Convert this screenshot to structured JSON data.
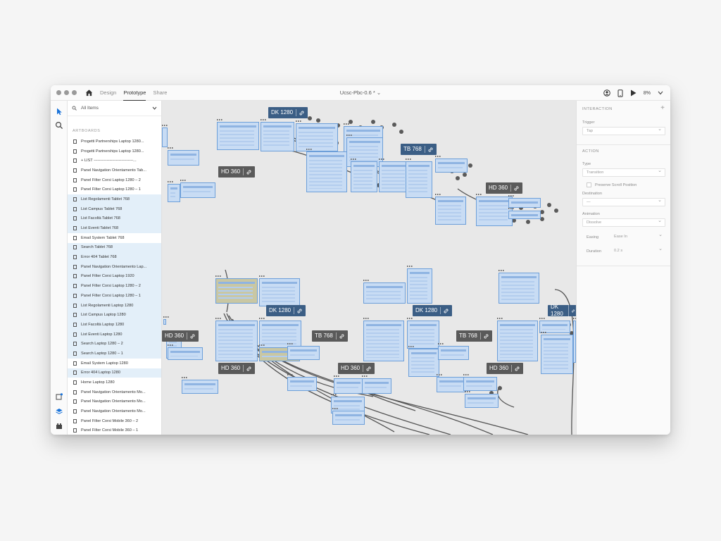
{
  "titlebar": {
    "tabs": [
      "Design",
      "Prototype",
      "Share"
    ],
    "active_tab": "Prototype",
    "document_title": "Ucsc-Pbc-0.6 * ⌄",
    "zoom": "8%"
  },
  "layers": {
    "search_label": "All Items",
    "section_title": "ARTBOARDS",
    "items": [
      {
        "label": "Progetti Partnerships Laptop 1280...",
        "selected": false
      },
      {
        "label": "Progetti Partnerships Laptop 1280...",
        "selected": false
      },
      {
        "label": "+ LIST ------------------------------...",
        "selected": false
      },
      {
        "label": "Panel Navigation Orientamento Tab...",
        "selected": false
      },
      {
        "label": "Panel Filter Corsi Laptop 1280 – 2",
        "selected": false
      },
      {
        "label": "Panel Filter Corsi Laptop 1280 – 1",
        "selected": false
      },
      {
        "label": "List Regolamenti Tablet 768",
        "selected": true
      },
      {
        "label": "List Campus Tablet 768",
        "selected": true
      },
      {
        "label": "List Facoltà Tablet 768",
        "selected": true
      },
      {
        "label": "List Eventi Tablet 768",
        "selected": true
      },
      {
        "label": "Email System Tablet 768",
        "selected": false
      },
      {
        "label": "Search Tablet 768",
        "selected": true
      },
      {
        "label": "Error 404 Tablet 768",
        "selected": true
      },
      {
        "label": "Panel Navigation Orientamento Lap...",
        "selected": true
      },
      {
        "label": "Panel Filter Corsi Laptop 1920",
        "selected": true
      },
      {
        "label": "Panel Filter Corsi Laptop 1280 – 2",
        "selected": true
      },
      {
        "label": "Panel Filter Corsi Laptop 1280 – 1",
        "selected": true
      },
      {
        "label": "List Regolamenti Laptop 1280",
        "selected": true
      },
      {
        "label": "List Campus Laptop 1280",
        "selected": true
      },
      {
        "label": "List Facoltà Laptop 1280",
        "selected": true
      },
      {
        "label": "List Eventi Laptop 1280",
        "selected": true
      },
      {
        "label": "Search Laptop 1280 – 2",
        "selected": true
      },
      {
        "label": "Search Laptop 1280 – 1",
        "selected": true
      },
      {
        "label": "Email System Laptop 1280",
        "selected": false
      },
      {
        "label": "Error 404 Laptop 1280",
        "selected": true
      },
      {
        "label": "Home Laptop 1280",
        "selected": false
      },
      {
        "label": "Panel Navigation Orientamento Mo...",
        "selected": false
      },
      {
        "label": "Panel Navigation Orientamento Mo...",
        "selected": false
      },
      {
        "label": "Panel Navigation Orientamento Mo...",
        "selected": false
      },
      {
        "label": "Panel Filter Corsi Mobile 360 – 2",
        "selected": false
      },
      {
        "label": "Panel Filter Corsi Mobile 360 – 1",
        "selected": false
      }
    ]
  },
  "canvas": {
    "tags": [
      {
        "label": "DK 1280",
        "style": "blue"
      },
      {
        "label": "TB 768",
        "style": "blue"
      },
      {
        "label": "HD 360",
        "style": "gray"
      },
      {
        "label": "HD 360",
        "style": "gray"
      },
      {
        "label": "DK 1280",
        "style": "blue"
      },
      {
        "label": "DK 1280",
        "style": "blue"
      },
      {
        "label": "DK 1280",
        "style": "blue"
      },
      {
        "label": "TB 768",
        "style": "gray"
      },
      {
        "label": "TB 768",
        "style": "gray"
      },
      {
        "label": "TB 768",
        "style": "gray"
      },
      {
        "label": "HD 360",
        "style": "gray"
      },
      {
        "label": "HD 360",
        "style": "gray"
      },
      {
        "label": "HD 360",
        "style": "gray"
      },
      {
        "label": "HD 360",
        "style": "gray"
      }
    ]
  },
  "inspector": {
    "interaction_title": "INTERACTION",
    "add_symbol": "+",
    "trigger_label": "Trigger",
    "trigger_value": "Tap",
    "action_title": "ACTION",
    "type_label": "Type",
    "type_value": "Transition",
    "preserve_scroll_label": "Preserve Scroll Position",
    "destination_label": "Destination",
    "destination_value": "—",
    "animation_label": "Animation",
    "animation_value": "Dissolve",
    "easing_label": "Easing",
    "easing_value": "Ease In",
    "duration_label": "Duration",
    "duration_value": "0.2 s"
  },
  "colors": {
    "selection_blue": "#c8dcf4",
    "artboard_border": "#6d9fd9",
    "tag_gray": "#5a5a5a",
    "tag_blue": "#3b5e85",
    "wire": "#555555"
  }
}
